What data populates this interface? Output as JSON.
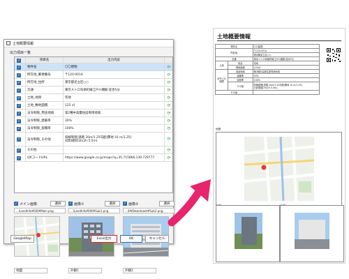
{
  "dialog": {
    "title": "土地概要情報",
    "group_label": "出力項目一覧",
    "columns": {
      "name": "項目名",
      "content": "出力内容"
    },
    "rows": [
      {
        "name": "物件名",
        "value": "〇〇建物"
      },
      {
        "name": "所在地_郵便番号",
        "value": "〒120-0014"
      },
      {
        "name": "所在地_住所",
        "value": "東京都足立区○○"
      },
      {
        "name": "交通",
        "value": "東京メトロ有楽町線江戸川橋駅 徒歩5分"
      },
      {
        "name": "土地_地目",
        "value": "宅地"
      },
      {
        "name": "土地_敷地面積",
        "value": "125 ㎡"
      },
      {
        "name": "法令制限_用途地域",
        "value": "第2種中高層住居専用地域"
      },
      {
        "name": "法令制限_建蔽率",
        "value": "30%"
      },
      {
        "name": "法令制限_容積率",
        "value": "100%"
      },
      {
        "name": "法令制限_その他",
        "value": "斜線制限[道路 20m/1.25勾配|隣地 10 m/1.25]\n日影規制[3h/2h-5.5m]"
      },
      {
        "name": "その他",
        "value": ""
      },
      {
        "name": "QRコードURL",
        "value": "https://www.google.co.jp/maps?q=35.715866,139.729777"
      }
    ],
    "images": [
      {
        "label": "メイン画像",
        "select": "選択",
        "path": "...\\LandInfo¥000¥Main.png"
      },
      {
        "label": "画像①",
        "select": "選択",
        "path": "...\\LandInfo¥000¥Sub1.png"
      },
      {
        "label": "画像②",
        "select": "選択",
        "path": "...\\H¥Downloads¥Sub2.png"
      }
    ],
    "captions": [
      "地図",
      "外観1",
      "外観2"
    ],
    "buttons": {
      "googlemap": "GoogleMap",
      "excel": "Excel出力",
      "ok": "OK",
      "cancel": "キャンセル"
    }
  },
  "document": {
    "title": "土地概要情報",
    "table": {
      "property_label": "物件名",
      "property_value": "〇〇建物",
      "location_label": "所在地",
      "zip": "〒120-0014",
      "address": "東京都足立区○○",
      "traffic_label": "交通",
      "traffic_value": "東京メトロ有楽町線江戸川橋駅 徒歩5分",
      "land_label": "土地",
      "chimoku_label": "地目",
      "chimoku_value": "宅地",
      "area_label": "敷地面積",
      "area_value": "125㎡",
      "law_label": "法令上の制限",
      "zone_label": "用途地域",
      "zone_value": "第2種中高層住居専用地域",
      "bcr_label": "建蔽率",
      "bcr_value": "30%",
      "far_label": "容積率",
      "far_value": "100%",
      "other_law_label": "その他",
      "other_law_value": "斜線制限[道路 20m/1.25勾配|隣地 10 m/1.25]\n日影規制[3h/2h-5.5m]",
      "other_label": "その他",
      "other_value": ""
    },
    "map_label": "地図",
    "ext1_label": "外観1",
    "ext2_label": "外観2"
  },
  "colors": {
    "accent": "#2b6cb0",
    "refresh": "#1f9a44",
    "arrow": "#e8246d",
    "highlight": "#e0202a"
  }
}
